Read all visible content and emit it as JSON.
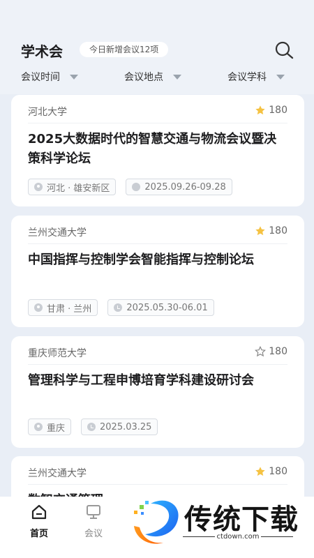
{
  "header": {
    "title": "学术会",
    "new_today": "今日新增会议12项"
  },
  "filters": [
    {
      "label": "会议时间"
    },
    {
      "label": "会议地点"
    },
    {
      "label": "会议学科"
    }
  ],
  "cards": [
    {
      "org": "河北大学",
      "count": "180",
      "starred": true,
      "title": "2025大数据时代的智慧交通与物流会议暨决策科学论坛",
      "location": "河北 · 雄安新区",
      "date": "2025.09.26-09.28"
    },
    {
      "org": "兰州交通大学",
      "count": "180",
      "starred": true,
      "title": "中国指挥与控制学会智能指挥与控制论坛",
      "location": "甘肃 · 兰州",
      "date": "2025.05.30-06.01"
    },
    {
      "org": "重庆师范大学",
      "count": "180",
      "starred": false,
      "title": "管理科学与工程申博培育学科建设研讨会",
      "location": "重庆",
      "date": "2025.03.25"
    },
    {
      "org": "兰州交通大学",
      "count": "180",
      "starred": true,
      "title": "数智交通管理"
    }
  ],
  "tabbar": [
    {
      "label": "首页",
      "icon": "home-icon",
      "active": true
    },
    {
      "label": "会议",
      "icon": "monitor-icon",
      "active": false
    }
  ],
  "watermark": {
    "brand": "传统下载",
    "url": "ctdown.com"
  },
  "colors": {
    "background": "#e9eef6",
    "star_filled": "#f5c242",
    "card": "#ffffff"
  }
}
